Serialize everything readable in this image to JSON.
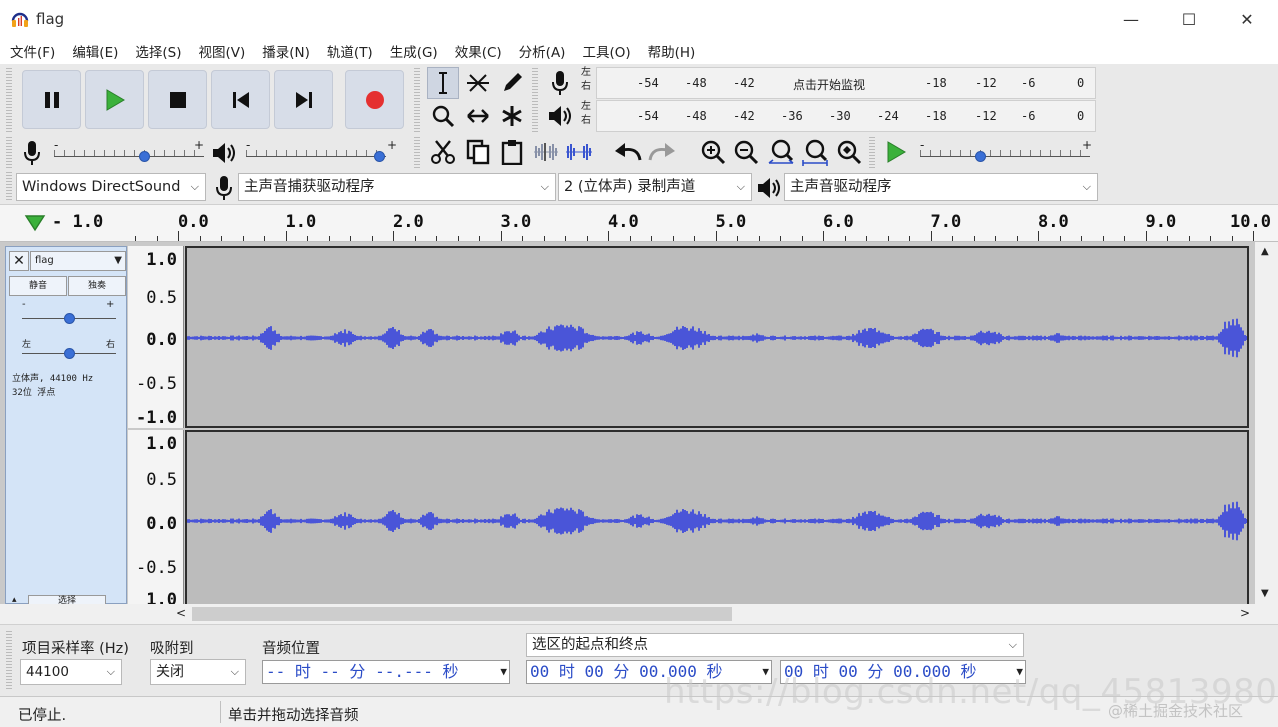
{
  "window": {
    "title": "flag",
    "controls": [
      "—",
      "☐",
      "✕"
    ]
  },
  "menu": [
    "文件(F)",
    "编辑(E)",
    "选择(S)",
    "视图(V)",
    "播录(N)",
    "轨道(T)",
    "生成(G)",
    "效果(C)",
    "分析(A)",
    "工具(O)",
    "帮助(H)"
  ],
  "meters": {
    "record": {
      "left_char": "左",
      "right_char": "右",
      "ticks": [
        "-54",
        "-48",
        "-42",
        "点击开始监视",
        "-18",
        "-12",
        "-6",
        "0"
      ]
    },
    "play": {
      "left_char": "左",
      "right_char": "右",
      "ticks": [
        "-54",
        "-48",
        "-42",
        "-36",
        "-30",
        "-24",
        "-18",
        "-12",
        "-6",
        "0"
      ]
    }
  },
  "mixer": {
    "minus": "-",
    "plus": "+",
    "record_volume": 0.6,
    "play_volume": 0.95
  },
  "play_at_speed": {
    "minus": "-",
    "plus": "+",
    "speed": 0.35
  },
  "device": {
    "host": "Windows DirectSound",
    "record_device": "主声音捕获驱动程序",
    "channels": "2 (立体声) 录制声道",
    "play_device": "主声音驱动程序"
  },
  "ruler": {
    "labels": [
      "- 1.0",
      "0.0",
      "1.0",
      "2.0",
      "3.0",
      "4.0",
      "5.0",
      "6.0",
      "7.0",
      "8.0",
      "9.0",
      "10.0"
    ]
  },
  "track": {
    "close": "✕",
    "name": "flag",
    "mute": "静音",
    "solo": "独奏",
    "gain_minus": "-",
    "gain_plus": "+",
    "pan_left": "左",
    "pan_right": "右",
    "gain": 0.5,
    "pan": 0.5,
    "info_line1": "立体声, 44100 Hz",
    "info_line2": "32位 浮点",
    "select": "选择",
    "scale_top": [
      "1.0",
      "0.5",
      "0.0",
      "-0.5",
      "-1.0"
    ],
    "scale_bottom": [
      "1.0",
      "0.5",
      "0.0",
      "-0.5",
      "1.0"
    ]
  },
  "selection": {
    "rate_label": "项目采样率 (Hz)",
    "rate_value": "44100",
    "snap_label": "吸附到",
    "snap_value": "关闭",
    "position_label": "音频位置",
    "position_value": "-- 时 -- 分 --.--- 秒",
    "range_label": "选区的起点和终点",
    "range_start": "00 时 00 分 00.000 秒",
    "range_end": "00 时 00 分 00.000 秒"
  },
  "status": {
    "state": "已停止.",
    "hint": "单击并拖动选择音频"
  },
  "watermark": {
    "url": "https://blog.csdn.net/qq_45813980",
    "site": "@稀土掘金技术社区"
  },
  "colors": {
    "wave": "#4a55d8",
    "record": "#e53030",
    "play": "#3bb13b",
    "track_bg": "#bcbcbc"
  }
}
